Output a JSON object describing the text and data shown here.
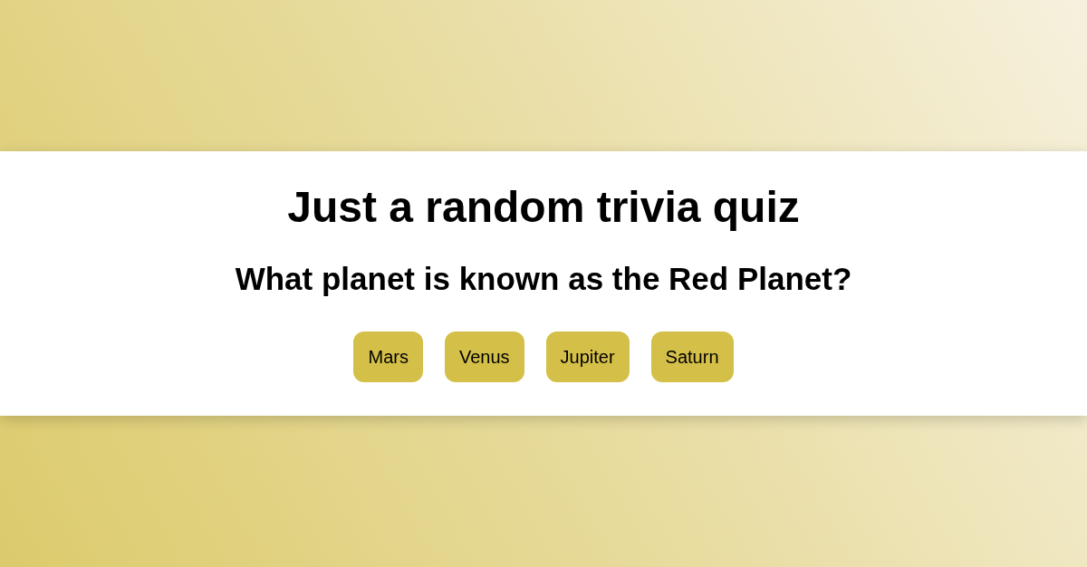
{
  "quiz": {
    "title": "Just a random trivia quiz",
    "question": "What planet is known as the Red Planet?",
    "answers": [
      {
        "label": "Mars"
      },
      {
        "label": "Venus"
      },
      {
        "label": "Jupiter"
      },
      {
        "label": "Saturn"
      }
    ]
  }
}
